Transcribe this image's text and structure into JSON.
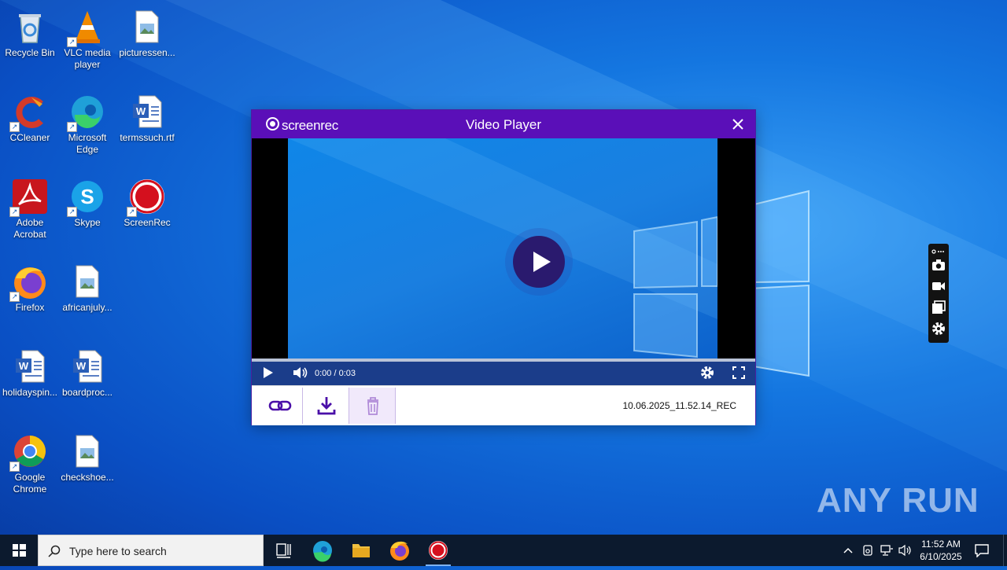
{
  "desktop": {
    "icons": [
      {
        "label": "Recycle Bin"
      },
      {
        "label": "VLC media player"
      },
      {
        "label": "picturessen..."
      },
      {
        "label": "CCleaner"
      },
      {
        "label": "Microsoft Edge"
      },
      {
        "label": "termssuch.rtf"
      },
      {
        "label": "Adobe Acrobat"
      },
      {
        "label": "Skype"
      },
      {
        "label": "ScreenRec"
      },
      {
        "label": "Firefox"
      },
      {
        "label": "africanjuly..."
      },
      {
        "label": "holidayspin..."
      },
      {
        "label": "boardproc..."
      },
      {
        "label": "Google Chrome"
      },
      {
        "label": "checkshoe..."
      }
    ]
  },
  "player": {
    "brand": "screenrec",
    "title": "Video Player",
    "time": "0:00 / 0:03",
    "progress": 0,
    "filename": "10.06.2025_11.52.14_REC",
    "accent": "#5a0fb8"
  },
  "watermark": "ANY RUN",
  "taskbar": {
    "search_placeholder": "Type here to search",
    "clock_time": "11:52 AM",
    "clock_date": "6/10/2025",
    "pinned": [
      "task-view-icon",
      "edge-icon",
      "file-explorer-icon",
      "firefox-icon",
      "screenrec-icon"
    ]
  },
  "side_toolbar": {
    "items": [
      "screenshot-icon",
      "video-record-icon",
      "gallery-icon",
      "settings-icon"
    ]
  }
}
